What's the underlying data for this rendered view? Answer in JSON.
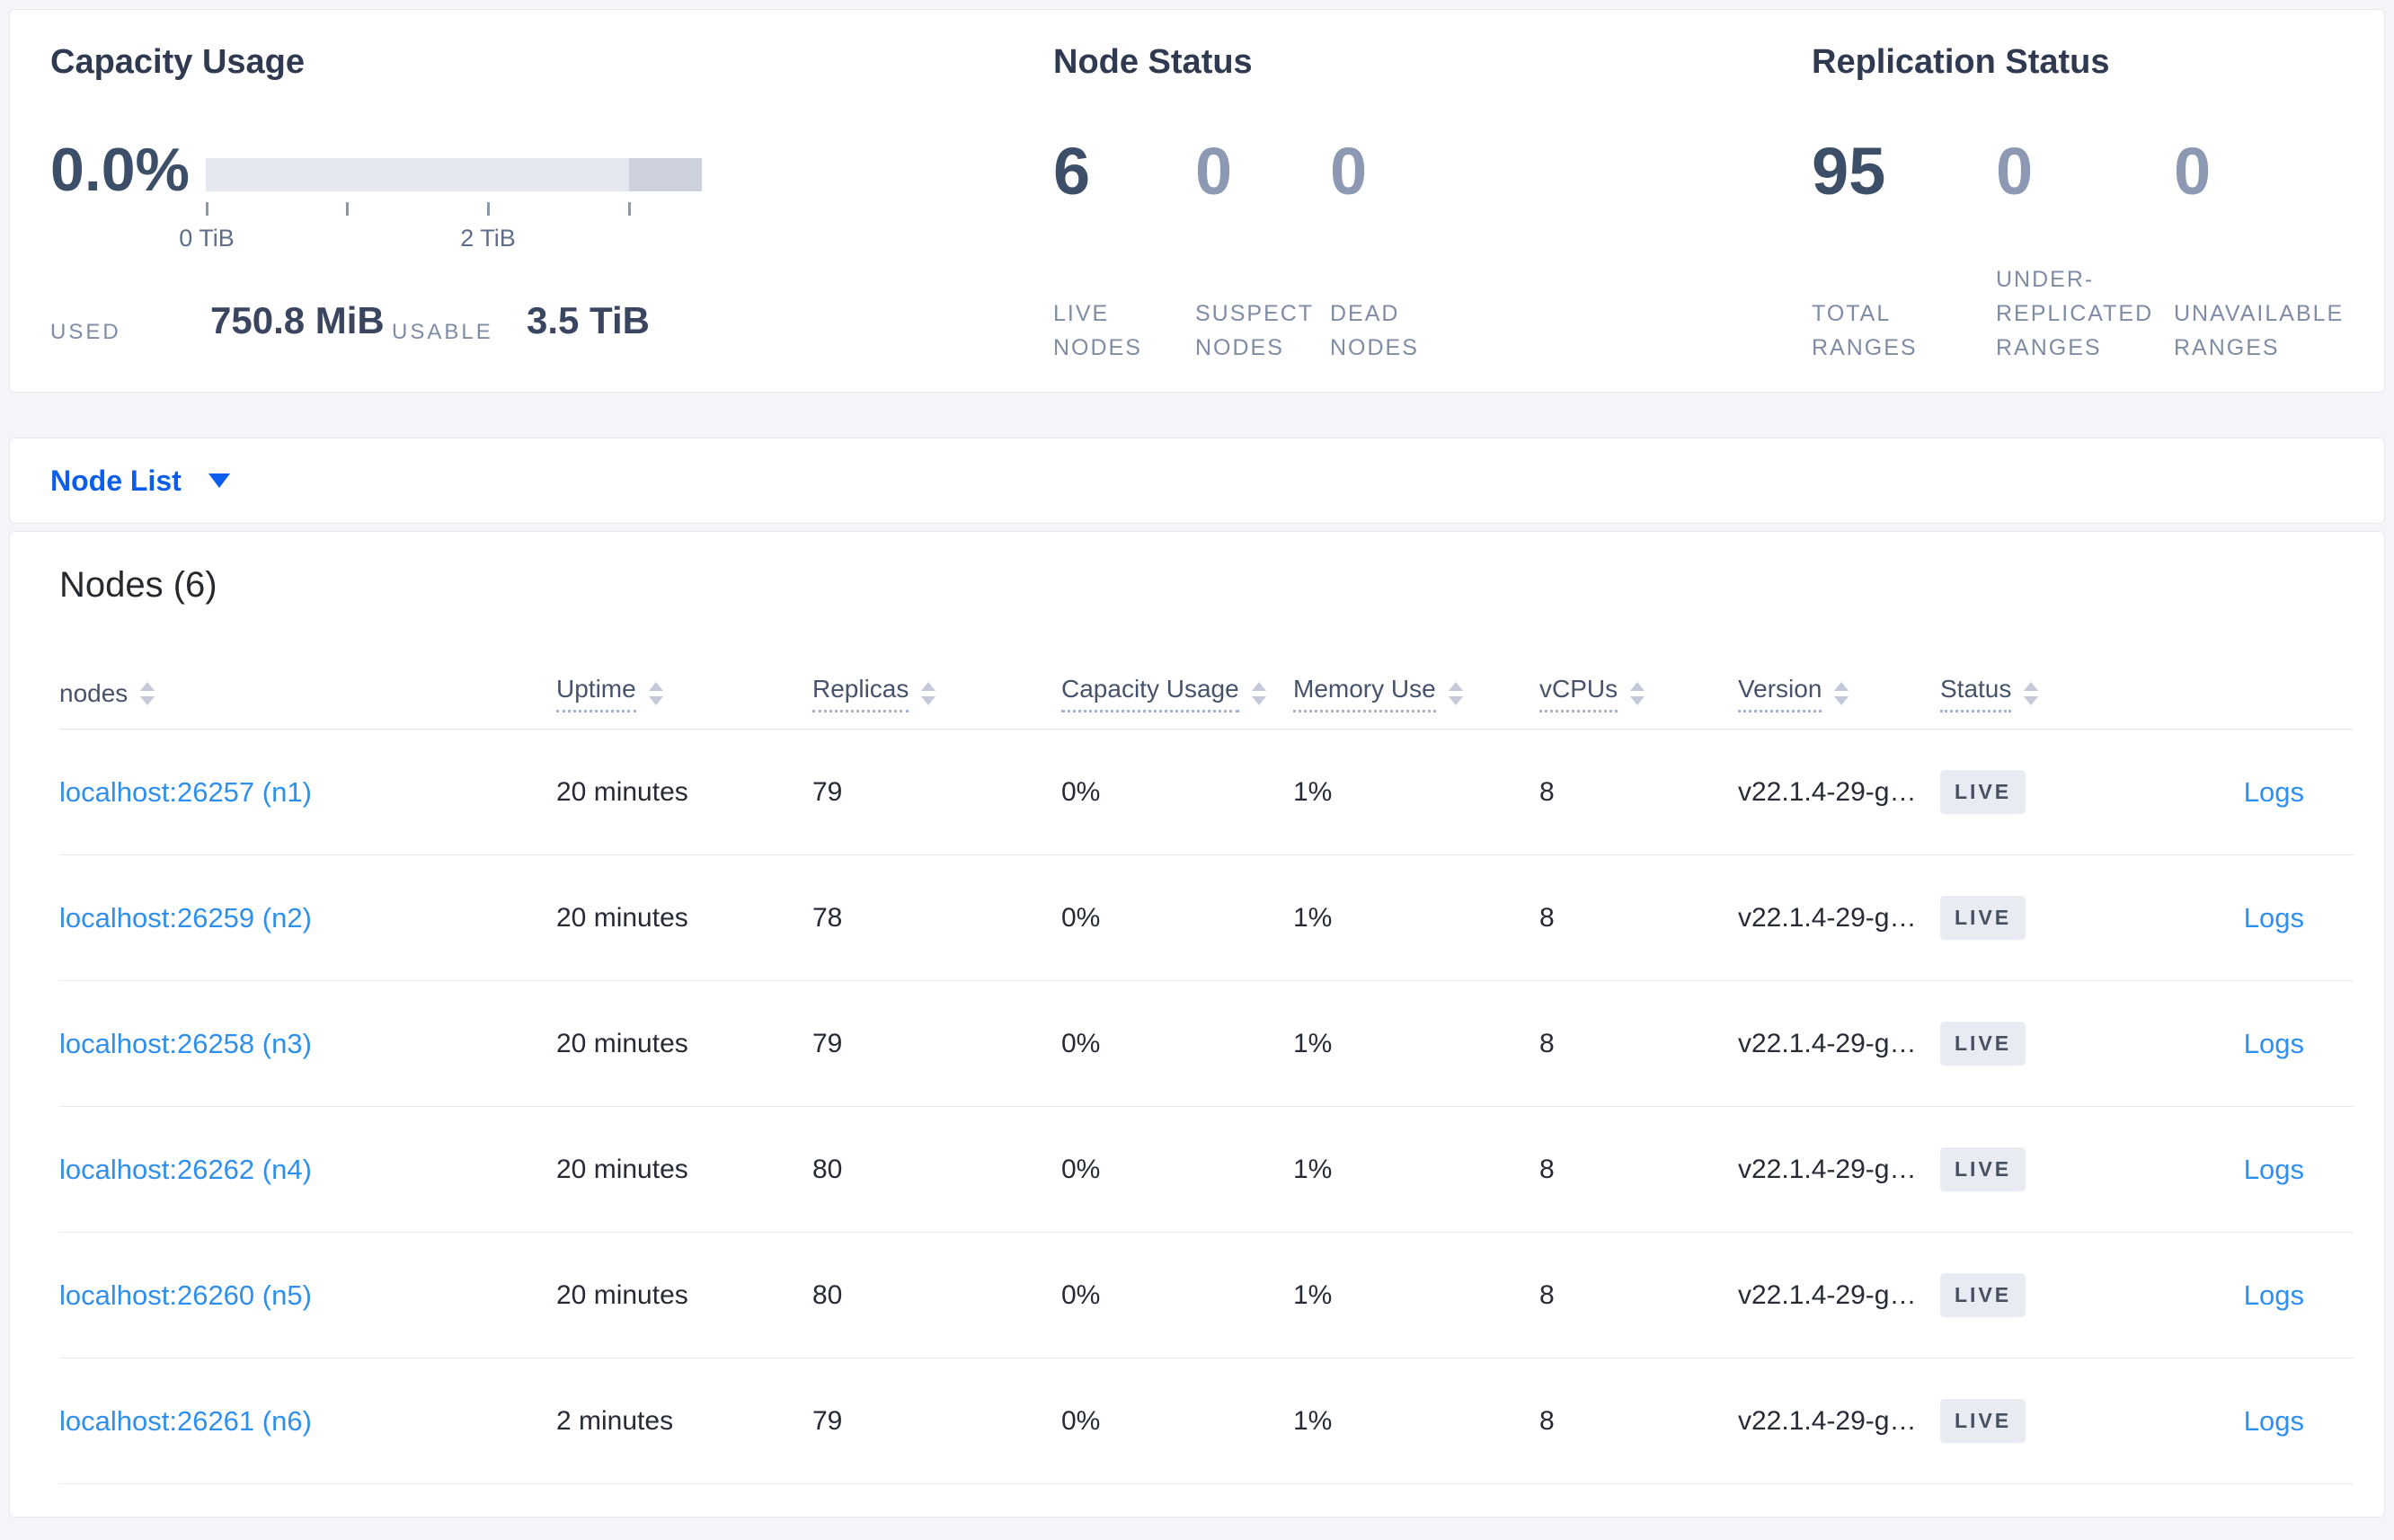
{
  "capacity": {
    "title": "Capacity Usage",
    "percent": "0.0%",
    "bar": {
      "ticks": [
        "0 TiB",
        "",
        "2 TiB",
        ""
      ],
      "dark_segment_pct": 14.7
    },
    "used_label": "USED",
    "used_value": "750.8 MiB",
    "usable_label": "USABLE",
    "usable_value": "3.5 TiB"
  },
  "node_status": {
    "title": "Node Status",
    "metrics": [
      {
        "value": "6",
        "lines": [
          "LIVE",
          "NODES"
        ],
        "emphasis": "primary"
      },
      {
        "value": "0",
        "lines": [
          "SUSPECT",
          "NODES"
        ],
        "emphasis": "muted"
      },
      {
        "value": "0",
        "lines": [
          "DEAD",
          "NODES"
        ],
        "emphasis": "muted"
      }
    ]
  },
  "replication_status": {
    "title": "Replication Status",
    "metrics": [
      {
        "value": "95",
        "lines": [
          "TOTAL",
          "RANGES"
        ],
        "emphasis": "primary"
      },
      {
        "value": "0",
        "lines": [
          "UNDER-",
          "REPLICATED",
          "RANGES"
        ],
        "emphasis": "muted"
      },
      {
        "value": "0",
        "lines": [
          "UNAVAILABLE",
          "RANGES"
        ],
        "emphasis": "muted"
      }
    ]
  },
  "view_selector": {
    "label": "Node List"
  },
  "nodes_section": {
    "title": "Nodes (6)",
    "columns": [
      {
        "label": "nodes",
        "underlined": false
      },
      {
        "label": "Uptime",
        "underlined": true
      },
      {
        "label": "Replicas",
        "underlined": true
      },
      {
        "label": "Capacity Usage",
        "underlined": true
      },
      {
        "label": "Memory Use",
        "underlined": true
      },
      {
        "label": "vCPUs",
        "underlined": true
      },
      {
        "label": "Version",
        "underlined": true
      },
      {
        "label": "Status",
        "underlined": true
      }
    ],
    "rows": [
      {
        "address": "localhost:26257 (n1)",
        "uptime": "20 minutes",
        "replicas": "79",
        "capacity_usage": "0%",
        "memory_use": "1%",
        "vcpus": "8",
        "version": "v22.1.4-29-g…",
        "status": "LIVE",
        "logs": "Logs"
      },
      {
        "address": "localhost:26259 (n2)",
        "uptime": "20 minutes",
        "replicas": "78",
        "capacity_usage": "0%",
        "memory_use": "1%",
        "vcpus": "8",
        "version": "v22.1.4-29-g…",
        "status": "LIVE",
        "logs": "Logs"
      },
      {
        "address": "localhost:26258 (n3)",
        "uptime": "20 minutes",
        "replicas": "79",
        "capacity_usage": "0%",
        "memory_use": "1%",
        "vcpus": "8",
        "version": "v22.1.4-29-g…",
        "status": "LIVE",
        "logs": "Logs"
      },
      {
        "address": "localhost:26262 (n4)",
        "uptime": "20 minutes",
        "replicas": "80",
        "capacity_usage": "0%",
        "memory_use": "1%",
        "vcpus": "8",
        "version": "v22.1.4-29-g…",
        "status": "LIVE",
        "logs": "Logs"
      },
      {
        "address": "localhost:26260 (n5)",
        "uptime": "20 minutes",
        "replicas": "80",
        "capacity_usage": "0%",
        "memory_use": "1%",
        "vcpus": "8",
        "version": "v22.1.4-29-g…",
        "status": "LIVE",
        "logs": "Logs"
      },
      {
        "address": "localhost:26261 (n6)",
        "uptime": "2 minutes",
        "replicas": "79",
        "capacity_usage": "0%",
        "memory_use": "1%",
        "vcpus": "8",
        "version": "v22.1.4-29-g…",
        "status": "LIVE",
        "logs": "Logs"
      }
    ]
  },
  "colors": {
    "accent-blue": "#0b5dea",
    "link-blue": "#2f8fec",
    "badge-bg": "#e8ebf1",
    "badge-text": "#475063",
    "bar-light": "#e4e7ef",
    "bar-dark": "#ccd1dd",
    "num-dark": "#3d4e68",
    "num-muted": "#8d99b3",
    "label-muted": "#7f8ca6",
    "page-bg": "#f4f5f9"
  }
}
